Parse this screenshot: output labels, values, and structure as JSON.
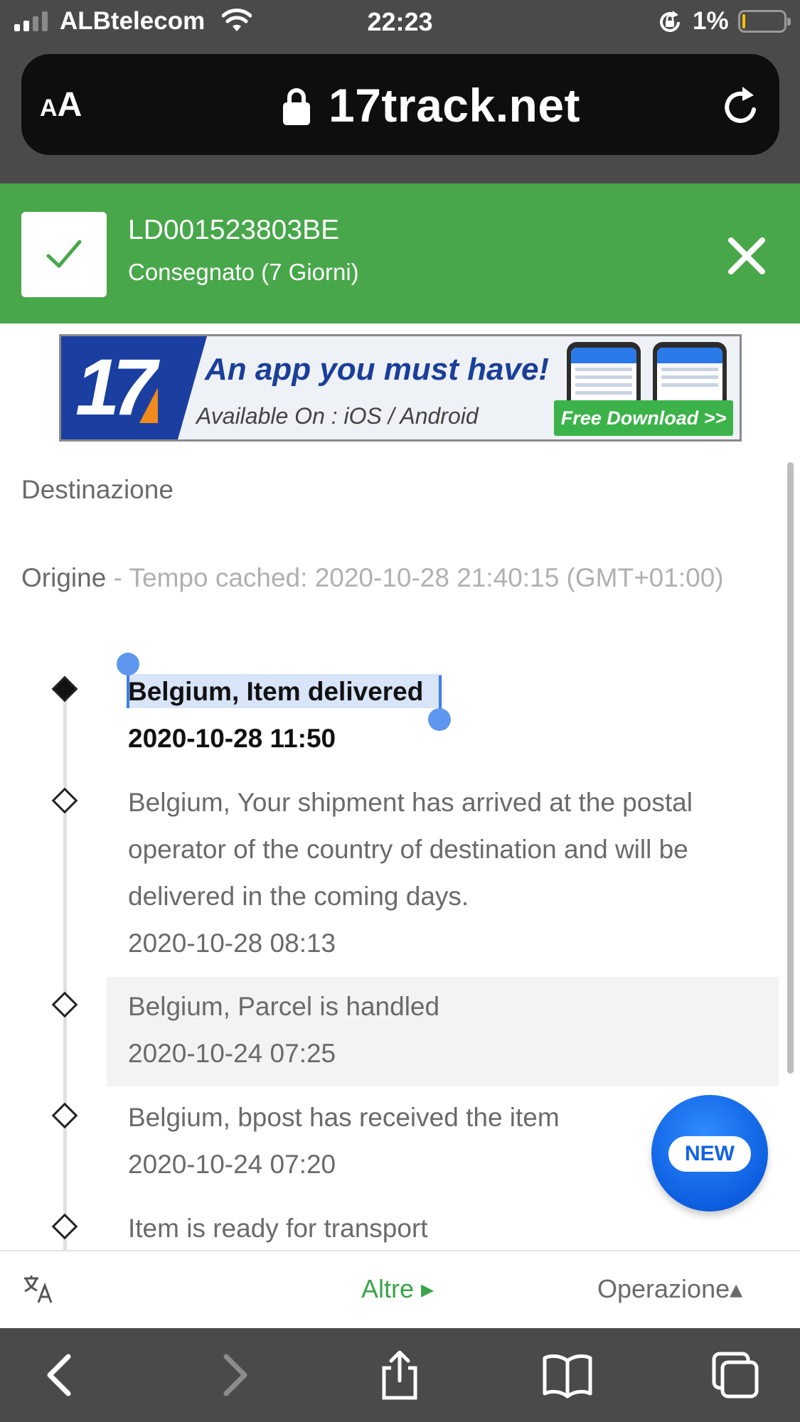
{
  "status_bar": {
    "carrier": "ALBtelecom",
    "time": "22:23",
    "battery_percent": "1%",
    "battery_level": 0.01,
    "icons": [
      "signal-icon",
      "wifi-icon",
      "rotation-lock-icon",
      "battery-icon"
    ]
  },
  "browser": {
    "text_size_small": "A",
    "text_size_big": "A",
    "domain": "17track.net",
    "icons": [
      "text-size-icon",
      "padlock-icon",
      "reload-icon"
    ]
  },
  "tracking": {
    "number": "LD001523803BE",
    "status": "Consegnato (7 Giorni)",
    "icons": [
      "check-icon",
      "close-icon"
    ]
  },
  "ad": {
    "logo": "17",
    "headline": "An app you must have!",
    "subline": "Available On : iOS / Android",
    "cta": "Free Download >>"
  },
  "content": {
    "destination_label": "Destinazione",
    "origin_label": "Origine",
    "cache_info": " - Tempo cached: 2020-10-28 21:40:15 (GMT+01:00)",
    "events": [
      {
        "desc": "Belgium, Item delivered",
        "time": "2020-10-28 11:50"
      },
      {
        "desc": "Belgium, Your shipment has arrived at the postal operator of the country of destination and will be delivered in the coming days.",
        "time": "2020-10-28 08:13"
      },
      {
        "desc": "Belgium, Parcel is handled",
        "time": "2020-10-24 07:25"
      },
      {
        "desc": "Belgium, bpost has received the item",
        "time": "2020-10-24 07:20"
      },
      {
        "desc": "Item is ready for transport",
        "time": ""
      }
    ],
    "new_badge": "NEW"
  },
  "footer": {
    "altre": "Altre ▸",
    "operazione": "Operazione▴",
    "icons": [
      "translate-icon"
    ]
  },
  "toolbar": {
    "icons": [
      "back-icon",
      "forward-icon",
      "share-icon",
      "bookmarks-icon",
      "tabs-icon"
    ]
  },
  "colors": {
    "chrome": "#4a4a4a",
    "banner_green": "#48a74a",
    "accent_blue": "#1b3fa1",
    "link_green": "#3aa449"
  }
}
